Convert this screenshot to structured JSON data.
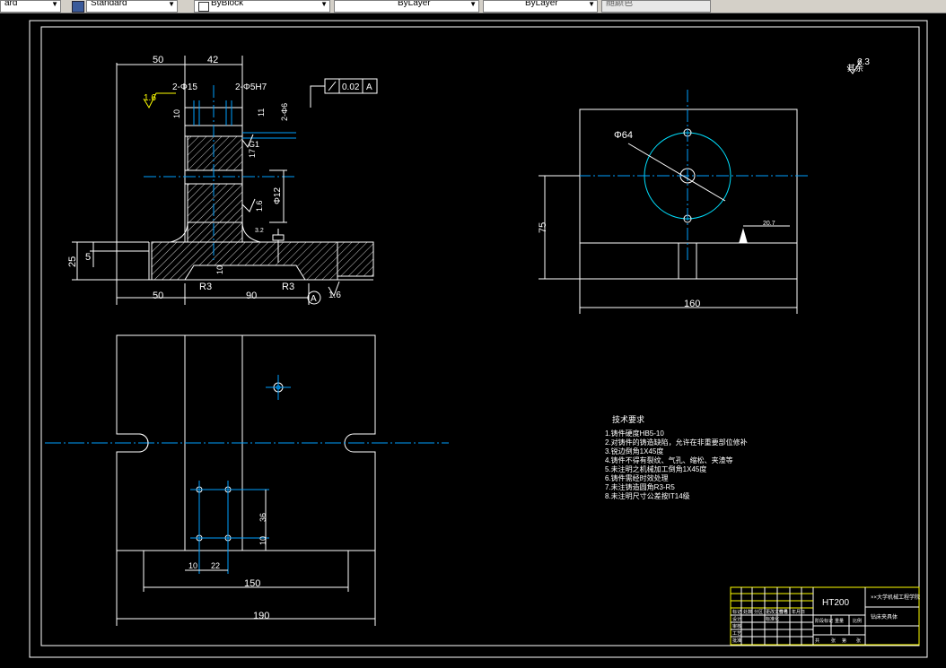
{
  "toolbar": {
    "textstyle_value": "Standard",
    "dimstyle_value": "Standard",
    "layer_value": "ByBlock",
    "linetype_value": "ByLayer",
    "lineweight_value": "ByLayer",
    "plotstyle_value": "随颜色",
    "textstyle_prefix": "ard"
  },
  "drawing": {
    "front_dims": {
      "top_50": "50",
      "top_42": "42",
      "bot_50": "50",
      "bot_90": "90",
      "left_25": "25",
      "left_5": "5",
      "hole1": "2-Φ15",
      "hole2": "2-Φ5H7",
      "hole3": "2-Φ6",
      "dia12": "Φ12",
      "r1": "R3",
      "r2": "R3",
      "d10a": "10",
      "d10b": "10",
      "d11": "11",
      "d17": "17",
      "rough16a": "1.6",
      "rough16b": "1.6",
      "rough16c": "1.6",
      "rough32": "3.2",
      "datumA": "A",
      "ftol_val": "0.02",
      "ftol_ref": "A",
      "rough_g1": "G1"
    },
    "right_dims": {
      "dia64": "Φ64",
      "h75": "75",
      "w160": "160",
      "d207": "20.7"
    },
    "plan_dims": {
      "w150": "150",
      "w190": "190",
      "h36": "36",
      "h10": "10",
      "w10": "10",
      "w22": "22"
    },
    "roughness_note": "6.3",
    "roughness_prefix": "其余",
    "notes": {
      "title": "技术要求",
      "items": [
        "1.铸件硬度HB5-10",
        "2.对铸件的铸造缺陷，允许在非重要部位修补",
        "3.锐边倒角1X45度",
        "4.铸件不得有裂纹、气孔、缩松、夹渣等",
        "5.未注明之机械加工倒角1X45度",
        "6.铸件需经时效处理",
        "7.未注铸造圆角R3-R5",
        "8.未注明尺寸公差按IT14级"
      ]
    },
    "titleblock": {
      "material": "HT200",
      "company": "××大学机械工程学院",
      "name": "钻床夹具体",
      "labels": [
        "标记",
        "处数",
        "分区",
        "更改文件号",
        "签名",
        "年月日",
        "设计",
        "标准化",
        "审核",
        "工艺",
        "批准",
        "阶段标记",
        "重量",
        "比例"
      ],
      "scale_row": [
        "共",
        "张",
        "第",
        "张"
      ]
    }
  },
  "colors": {
    "bg": "#000000",
    "line": "#ffffff",
    "center": "#00a0ff",
    "cyan": "#00e0ff",
    "yellow": "#ffff00",
    "green": "#00ff00"
  }
}
